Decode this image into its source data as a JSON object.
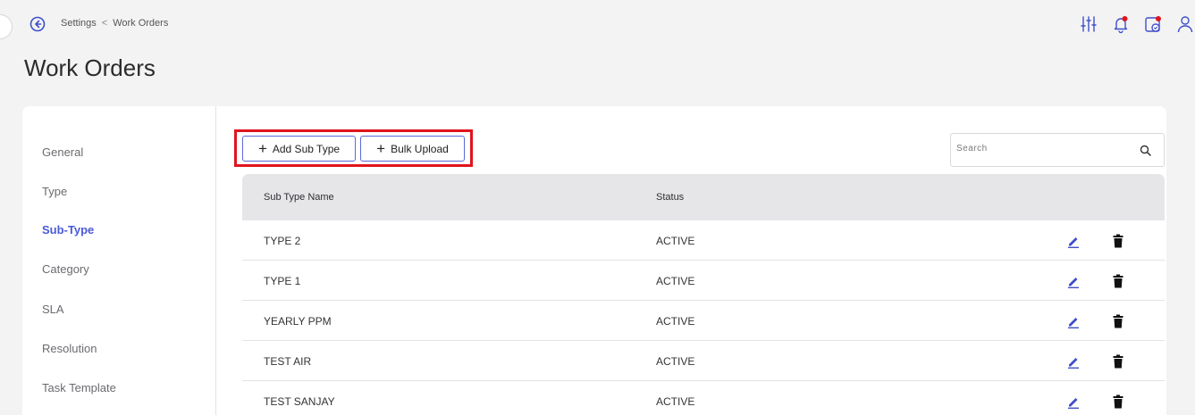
{
  "header": {
    "breadcrumb": {
      "parent": "Settings",
      "separator": "<",
      "current": "Work Orders"
    },
    "title": "Work Orders",
    "icons": [
      "filter-sliders-icon",
      "notification-bell-icon",
      "task-calendar-icon",
      "user-profile-icon"
    ]
  },
  "sidebar": {
    "items": [
      {
        "label": "General"
      },
      {
        "label": "Type"
      },
      {
        "label": "Sub-Type",
        "active": true
      },
      {
        "label": "Category"
      },
      {
        "label": "SLA"
      },
      {
        "label": "Resolution"
      },
      {
        "label": "Task Template"
      }
    ]
  },
  "actions": {
    "add_sub_type": "Add Sub Type",
    "bulk_upload": "Bulk Upload"
  },
  "search": {
    "placeholder": "Search",
    "value": ""
  },
  "table": {
    "columns": [
      "Sub Type Name",
      "Status"
    ],
    "rows": [
      {
        "name": "TYPE 2",
        "status": "ACTIVE"
      },
      {
        "name": "TYPE 1",
        "status": "ACTIVE"
      },
      {
        "name": "YEARLY PPM",
        "status": "ACTIVE"
      },
      {
        "name": "TEST AIR",
        "status": "ACTIVE"
      },
      {
        "name": "TEST SANJAY",
        "status": "ACTIVE"
      }
    ]
  },
  "colors": {
    "accent": "#4a5ad8",
    "highlight_frame": "#e0141e",
    "notification_dot": "#e0141e"
  }
}
